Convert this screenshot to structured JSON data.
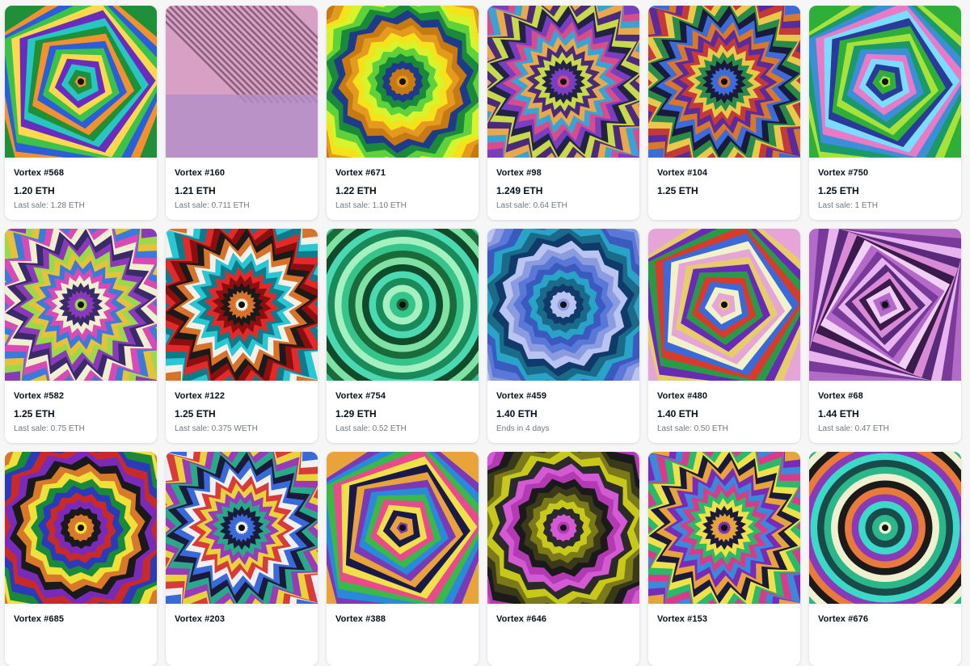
{
  "cards": [
    {
      "title": "Vortex #568",
      "price": "1.20 ETH",
      "sub": "Last sale: 1.28 ETH",
      "art": {
        "shape": "pentagon",
        "colors": [
          "#1f8f3a",
          "#f2912e",
          "#2b5fd9",
          "#3cc24a",
          "#ffd84d",
          "#6a2cbf",
          "#27c7c0"
        ]
      }
    },
    {
      "title": "Vortex #160",
      "price": "1.21 ETH",
      "sub": "Last sale: 0.711 ETH",
      "art": {
        "shape": "stripes",
        "colors": [
          "#d7a0c4",
          "#6f4a62",
          "#c797c6",
          "#b48fc8"
        ]
      }
    },
    {
      "title": "Vortex #671",
      "price": "1.22 ETH",
      "sub": "Last sale: 1.10 ETH",
      "art": {
        "shape": "flower",
        "colors": [
          "#c77a12",
          "#e49a1f",
          "#f4e21a",
          "#d8f22b",
          "#5fd13a",
          "#1a8a3a",
          "#203a8a"
        ]
      }
    },
    {
      "title": "Vortex #98",
      "price": "1.249 ETH",
      "sub": "Last sale: 0.64 ETH",
      "art": {
        "shape": "star",
        "colors": [
          "#7a3fbf",
          "#d94c8c",
          "#3aa3d6",
          "#e9a84a",
          "#4a2a7a",
          "#c8d94a",
          "#222244"
        ]
      }
    },
    {
      "title": "Vortex #104",
      "price": "1.25 ETH",
      "sub": "",
      "art": {
        "shape": "star",
        "colors": [
          "#3d6bd9",
          "#d8782a",
          "#5b2a9b",
          "#c43a3a",
          "#e9c94a",
          "#2a8a4a",
          "#1a1a3a"
        ]
      }
    },
    {
      "title": "Vortex #750",
      "price": "1.25 ETH",
      "sub": "Last sale: 1 ETH",
      "art": {
        "shape": "pentagon",
        "colors": [
          "#2fae3a",
          "#a6e23a",
          "#1a9a6a",
          "#3a8fd6",
          "#e87ac8",
          "#7adcff",
          "#2a3a9a"
        ]
      }
    },
    {
      "title": "Vortex #582",
      "price": "1.25 ETH",
      "sub": "Last sale: 0.75 ETH",
      "art": {
        "shape": "star",
        "colors": [
          "#8a3ab8",
          "#9ad94a",
          "#e7c13a",
          "#3a7ad9",
          "#d94ab4",
          "#f0f0d0",
          "#3a2a6a"
        ]
      }
    },
    {
      "title": "Vortex #122",
      "price": "1.25 ETH",
      "sub": "Last sale: 0.375 WETH",
      "art": {
        "shape": "star",
        "colors": [
          "#d8722a",
          "#f4f0ea",
          "#2ac6d4",
          "#0f7a8a",
          "#e32a2a",
          "#8a0f0f",
          "#1a1a1a"
        ]
      }
    },
    {
      "title": "Vortex #754",
      "price": "1.29 ETH",
      "sub": "Last sale: 0.52 ETH",
      "art": {
        "shape": "circle",
        "colors": [
          "#35c48a",
          "#1a6a3a",
          "#7fe2a4",
          "#0f4a2a",
          "#4ad9b0",
          "#1a8a5a",
          "#a4f0c0"
        ]
      }
    },
    {
      "title": "Vortex #459",
      "price": "1.40 ETH",
      "sub": "Ends in 4 days",
      "art": {
        "shape": "flower",
        "colors": [
          "#b9c4f0",
          "#8a9be0",
          "#5a78d8",
          "#3a5ac0",
          "#2aa3c8",
          "#1a6a8a",
          "#0f3a6a"
        ]
      }
    },
    {
      "title": "Vortex #480",
      "price": "1.40 ETH",
      "sub": "Last sale: 0.50 ETH",
      "art": {
        "shape": "pentagon",
        "colors": [
          "#e5a5d8",
          "#e7cd6a",
          "#6a2ab8",
          "#2a9a4a",
          "#d93a2a",
          "#3a6ad9",
          "#f2f2c8"
        ]
      }
    },
    {
      "title": "Vortex #68",
      "price": "1.44 ETH",
      "sub": "Last sale: 0.47 ETH",
      "art": {
        "shape": "square",
        "colors": [
          "#b46ac8",
          "#7a3a9a",
          "#e8b4f0",
          "#5a2a7a",
          "#d98ad4",
          "#3a1a4a",
          "#f0d0f4"
        ]
      }
    },
    {
      "title": "Vortex #685",
      "price": "",
      "sub": "",
      "art": {
        "shape": "flower",
        "colors": [
          "#d8782a",
          "#f0e03a",
          "#1a8a3a",
          "#2a3ab8",
          "#c82a2a",
          "#7a2ab8",
          "#1a1a1a"
        ]
      }
    },
    {
      "title": "Vortex #203",
      "price": "",
      "sub": "",
      "art": {
        "shape": "star",
        "colors": [
          "#3a6ad9",
          "#f0f0f0",
          "#d93a3a",
          "#e8d43a",
          "#9a3ab8",
          "#2aa88a",
          "#1a1a3a"
        ]
      }
    },
    {
      "title": "Vortex #388",
      "price": "",
      "sub": "",
      "art": {
        "shape": "pentagon",
        "colors": [
          "#e8a43a",
          "#7a3ab8",
          "#2a8ad9",
          "#3ab84a",
          "#e84a8a",
          "#f0e04a",
          "#1a1a4a"
        ]
      }
    },
    {
      "title": "Vortex #646",
      "price": "",
      "sub": "",
      "art": {
        "shape": "flower",
        "colors": [
          "#d45ad4",
          "#b43ab4",
          "#1a1a1a",
          "#3a3a1a",
          "#7a7a1a",
          "#c8c81a",
          "#2a2a2a"
        ]
      }
    },
    {
      "title": "Vortex #153",
      "price": "",
      "sub": "",
      "art": {
        "shape": "star",
        "colors": [
          "#e8a43a",
          "#7a2ab8",
          "#3a8ad9",
          "#d93a8a",
          "#2ab86a",
          "#f0e04a",
          "#1a1a3a"
        ]
      }
    },
    {
      "title": "Vortex #676",
      "price": "",
      "sub": "",
      "art": {
        "shape": "circle",
        "colors": [
          "#2ab88a",
          "#f0f0d0",
          "#1a1a1a",
          "#e87a3a",
          "#8a3ab8",
          "#3ad9c8",
          "#1a4a4a"
        ]
      }
    }
  ]
}
